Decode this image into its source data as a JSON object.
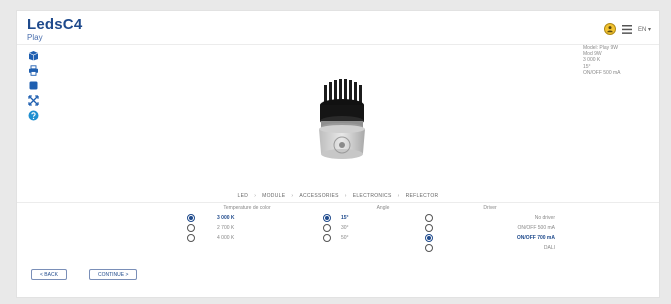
{
  "app": {
    "brand": "LedsC4",
    "product": "Play"
  },
  "header": {
    "language": "EN"
  },
  "specs": [
    "Model: Play 9W",
    "Mod 9W",
    "3 000 K",
    "15°",
    "ON/OFF 500 mA"
  ],
  "breadcrumb": [
    "LED",
    "MODULE",
    "ACCESSORIES",
    "ELECTRONICS",
    "REFLECTOR"
  ],
  "options": {
    "temperature": {
      "title": "Temperature de color",
      "items": [
        {
          "label": "3 000 K",
          "selected": true
        },
        {
          "label": "2 700 K",
          "selected": false
        },
        {
          "label": "4 000 K",
          "selected": false
        }
      ]
    },
    "angle": {
      "title": "Angle",
      "items": [
        {
          "label": "15°",
          "selected": true
        },
        {
          "label": "30°",
          "selected": false
        },
        {
          "label": "50°",
          "selected": false
        }
      ]
    },
    "driver": {
      "title": "Driver",
      "items": [
        {
          "label": "No driver",
          "selected": false
        },
        {
          "label": "ON/OFF 500 mA",
          "selected": false
        },
        {
          "label": "ON/OFF 700 mA",
          "selected": true
        },
        {
          "label": "DALI",
          "selected": false
        }
      ]
    }
  },
  "buttons": {
    "back": "< BACK",
    "continue": "CONTINUE >"
  },
  "colors": {
    "accent": "#1f4a8c",
    "icon": "#1f5fb0",
    "userIcon": "#f2c230"
  }
}
